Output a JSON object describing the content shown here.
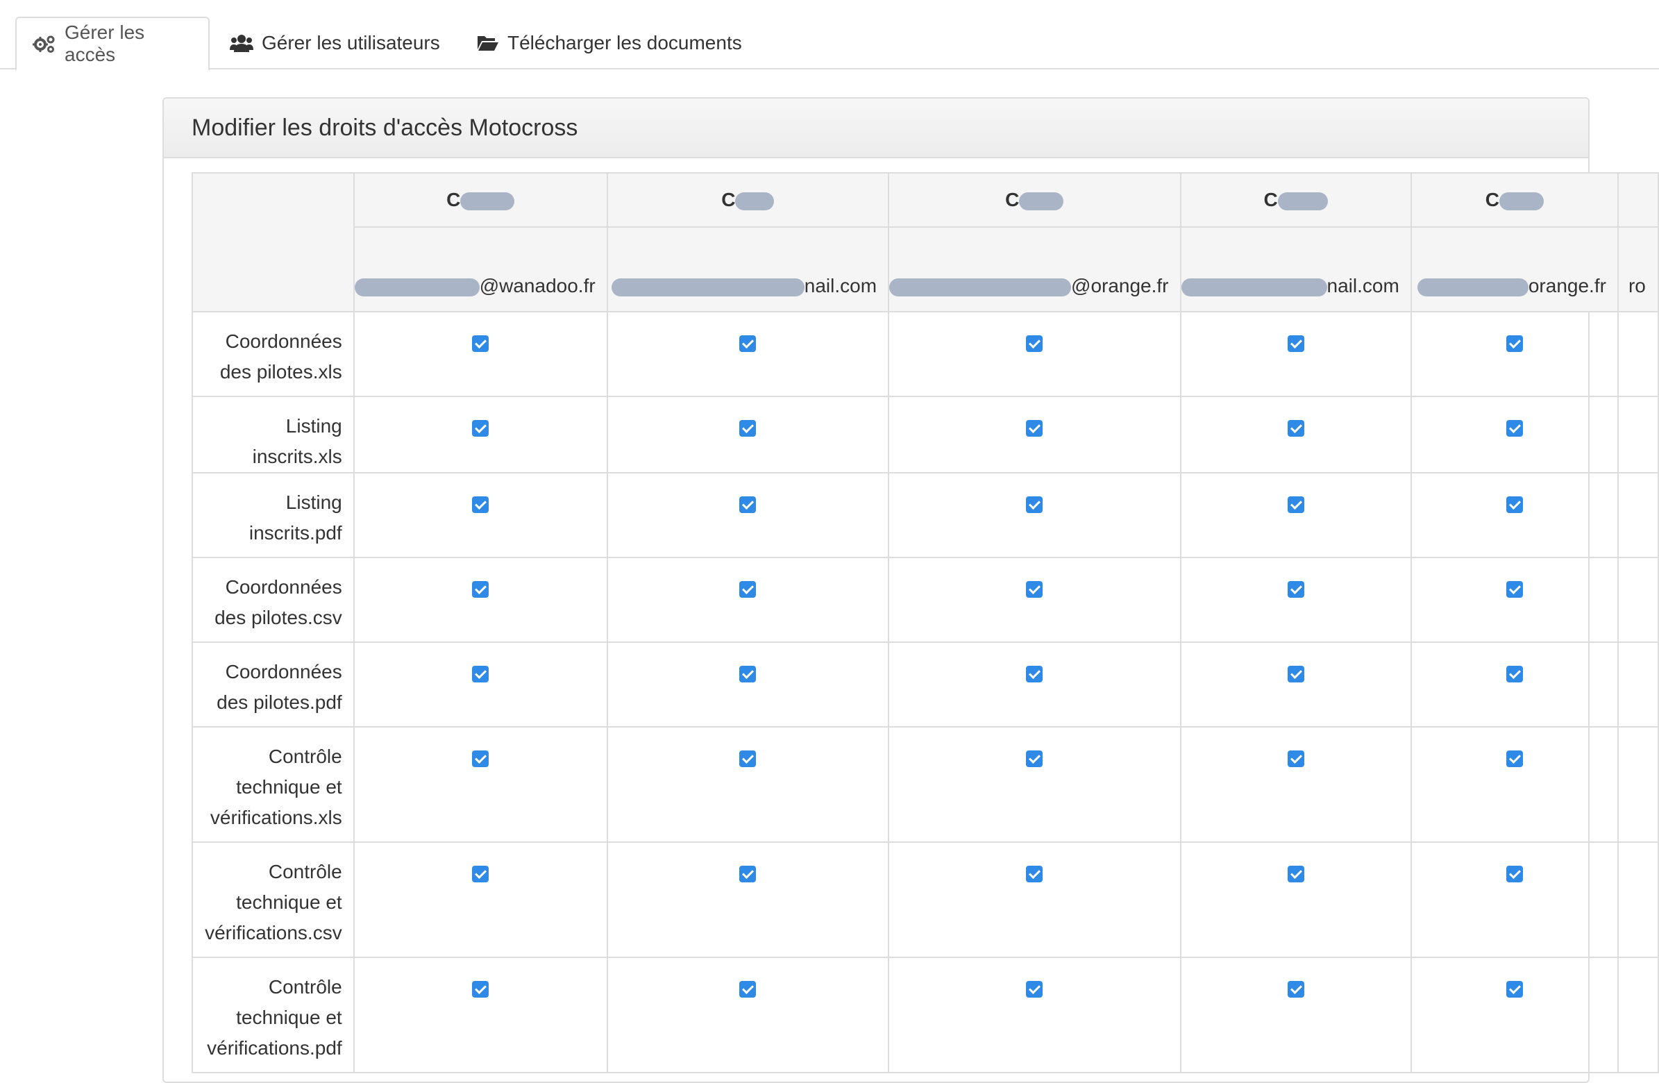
{
  "tabs": [
    {
      "label": "Gérer les accès",
      "icon": "gears-icon",
      "active": true
    },
    {
      "label": "Gérer les utilisateurs",
      "icon": "users-icon",
      "active": false
    },
    {
      "label": "Télécharger les documents",
      "icon": "folder-open-icon",
      "active": false
    }
  ],
  "panel": {
    "title": "Modifier les droits d'accès Motocross"
  },
  "users": [
    {
      "name_visible": "C",
      "email_visible": "@wanadoo.fr"
    },
    {
      "name_visible": "C",
      "email_visible": "nail.com"
    },
    {
      "name_visible": "C",
      "email_visible": "@orange.fr"
    },
    {
      "name_visible": "C",
      "email_visible": "nail.com"
    },
    {
      "name_visible": "C",
      "email_visible": "orange.fr"
    }
  ],
  "partial_column": {
    "email_visible": "ro"
  },
  "documents": [
    {
      "label": "Coordonnées des pilotes.xls",
      "access": [
        true,
        true,
        true,
        true,
        true
      ]
    },
    {
      "label": "Listing inscrits.xls",
      "access": [
        true,
        true,
        true,
        true,
        true
      ]
    },
    {
      "label": "Listing inscrits.pdf",
      "access": [
        true,
        true,
        true,
        true,
        true
      ]
    },
    {
      "label": "Coordonnées des pilotes.csv",
      "access": [
        true,
        true,
        true,
        true,
        true
      ]
    },
    {
      "label": "Coordonnées des pilotes.pdf",
      "access": [
        true,
        true,
        true,
        true,
        true
      ]
    },
    {
      "label": "Contrôle technique et vérifications.xls",
      "access": [
        true,
        true,
        true,
        true,
        true
      ]
    },
    {
      "label": "Contrôle technique et vérifications.csv",
      "access": [
        true,
        true,
        true,
        true,
        true
      ]
    },
    {
      "label": "Contrôle technique et vérifications.pdf",
      "access": [
        true,
        true,
        true,
        true,
        true
      ]
    }
  ],
  "colors": {
    "checkbox": "#2e8ae6",
    "redaction": "#a9b4c6",
    "border": "#dddddd"
  }
}
